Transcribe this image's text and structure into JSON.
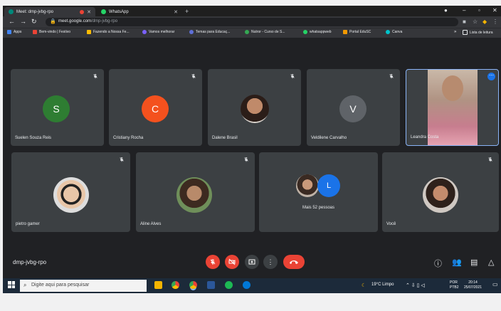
{
  "browser": {
    "tabs": [
      {
        "label": "Meet: dmp-jvbg-rpo",
        "active": true
      },
      {
        "label": "WhatsApp",
        "active": false
      }
    ],
    "url_domain": "meet.google.com",
    "url_path": "/dmp-jvbg-rpo",
    "bookmarks": [
      {
        "label": "Apps",
        "color": "#4285f4"
      },
      {
        "label": "Bem-vindo | Festivo",
        "color": "#ea4335"
      },
      {
        "label": "Fazendo a Nossa Fe...",
        "color": "#fbbc04"
      },
      {
        "label": "Vamos melhorar",
        "color": "#7b61ff"
      },
      {
        "label": "Temas para Educaç...",
        "color": "#5f6fd8"
      },
      {
        "label": "Nutror - Curso de S...",
        "color": "#34a853"
      },
      {
        "label": "whatsappweb",
        "color": "#25d366"
      },
      {
        "label": "Portal EduSC",
        "color": "#f29900"
      },
      {
        "label": "Canva",
        "color": "#00c4cc"
      }
    ],
    "reading_list": "Lista de leitura"
  },
  "meeting": {
    "code": "dmp-jvbg-rpo",
    "participants": [
      {
        "name": "Suelen Souza Reis",
        "initial": "S",
        "color": "#2e7d32"
      },
      {
        "name": "Cristiany Rocha",
        "initial": "C",
        "color": "#f4511e"
      },
      {
        "name": "Dalene Brasil",
        "initial": "",
        "color": ""
      },
      {
        "name": "Veldilene Carvalho",
        "initial": "V",
        "color": "#5f6368"
      },
      {
        "name": "Leandra Costa",
        "initial": "",
        "color": ""
      },
      {
        "name": "pietro gamer",
        "initial": "",
        "color": ""
      },
      {
        "name": "Aline Alves",
        "initial": "",
        "color": ""
      },
      {
        "name": "Mais 52 pessoas",
        "initial": "L",
        "color": "#1a73e8"
      },
      {
        "name": "Você",
        "initial": "",
        "color": ""
      }
    ],
    "more_icon": "⋯"
  },
  "taskbar": {
    "search_placeholder": "Digite aqui para pesquisar",
    "weather": "19°C  Limpo",
    "lang_top": "POR",
    "lang_bottom": "PTB2",
    "time": "20:14",
    "date": "25/07/2021"
  }
}
